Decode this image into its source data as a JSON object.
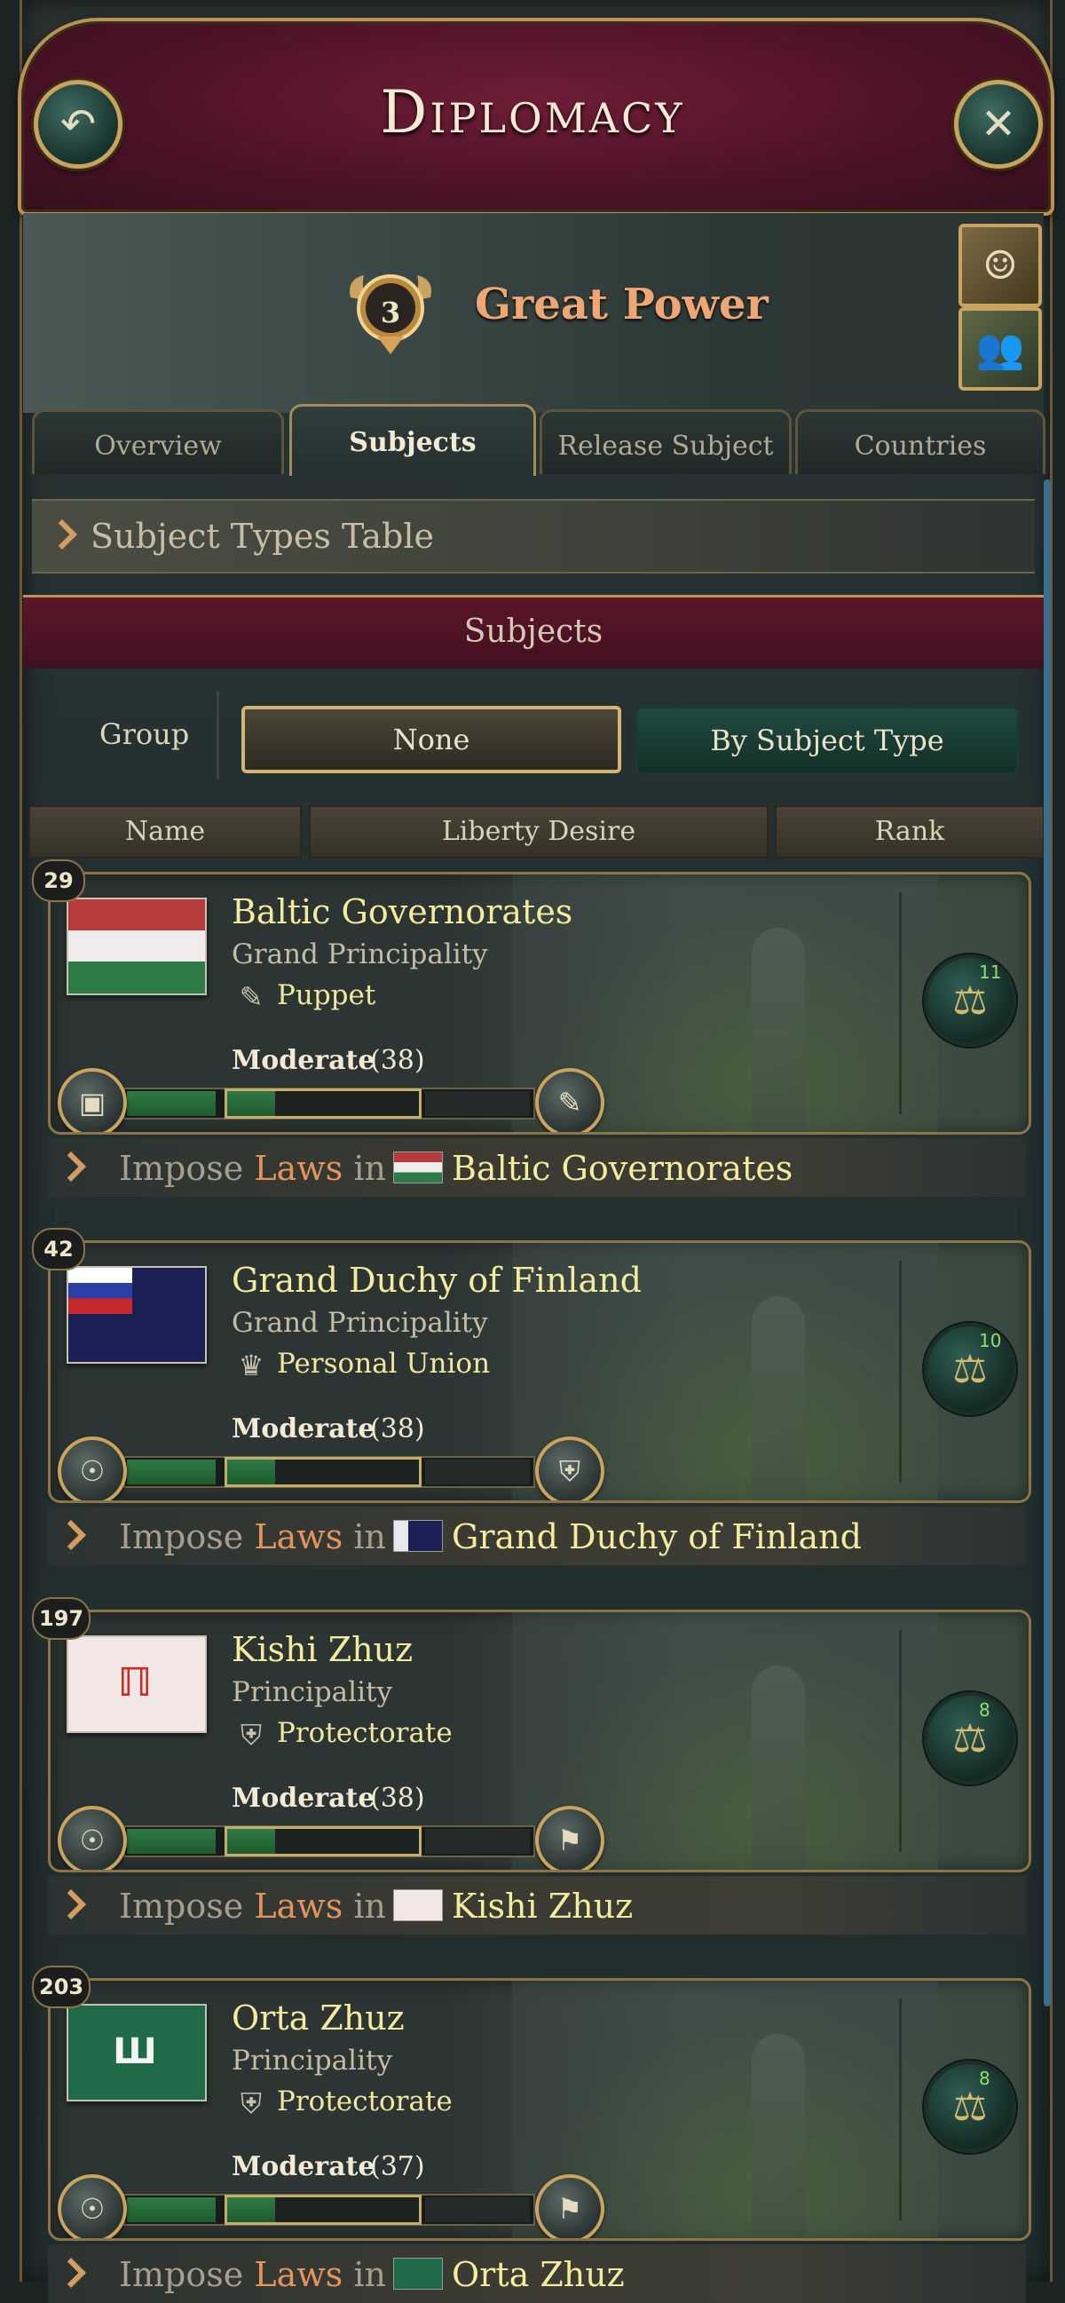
{
  "header": {
    "title": "Diplomacy",
    "back_icon": "↶",
    "close_icon": "✕"
  },
  "power": {
    "rank": "3",
    "label": "Great Power"
  },
  "tabs": [
    {
      "label": "Overview"
    },
    {
      "label": "Subjects"
    },
    {
      "label": "Release Subject"
    },
    {
      "label": "Countries"
    }
  ],
  "types_table": {
    "label": "Subject Types Table"
  },
  "subjects_header": {
    "label": "Subjects"
  },
  "grouping": {
    "label": "Group",
    "option_none": "None",
    "option_type": "By Subject Type"
  },
  "columns": {
    "name": "Name",
    "liberty": "Liberty Desire",
    "rank": "Rank"
  },
  "impose": {
    "word": "Impose",
    "laws": "Laws",
    "in": "in"
  },
  "subjects": [
    {
      "rank": "29",
      "name": "Baltic Governorates",
      "type": "Grand Principality",
      "relation": "Puppet",
      "relation_icon": "puppet-icon",
      "liberty": "Moderate",
      "liberty_value": "(38)",
      "laws_count": "11",
      "liberty_fraction": 0.38
    },
    {
      "rank": "42",
      "name": "Grand Duchy of Finland",
      "type": "Grand Principality",
      "relation": "Personal Union",
      "relation_icon": "crown-icon",
      "liberty": "Moderate",
      "liberty_value": "(38)",
      "laws_count": "10",
      "liberty_fraction": 0.38
    },
    {
      "rank": "197",
      "name": "Kishi Zhuz",
      "type": "Principality",
      "relation": "Protectorate",
      "relation_icon": "shield-icon",
      "liberty": "Moderate",
      "liberty_value": "(38)",
      "laws_count": "8",
      "liberty_fraction": 0.38
    },
    {
      "rank": "203",
      "name": "Orta Zhuz",
      "type": "Principality",
      "relation": "Protectorate",
      "relation_icon": "shield-icon",
      "liberty": "Moderate",
      "liberty_value": "(37)",
      "laws_count": "8",
      "liberty_fraction": 0.37
    }
  ]
}
